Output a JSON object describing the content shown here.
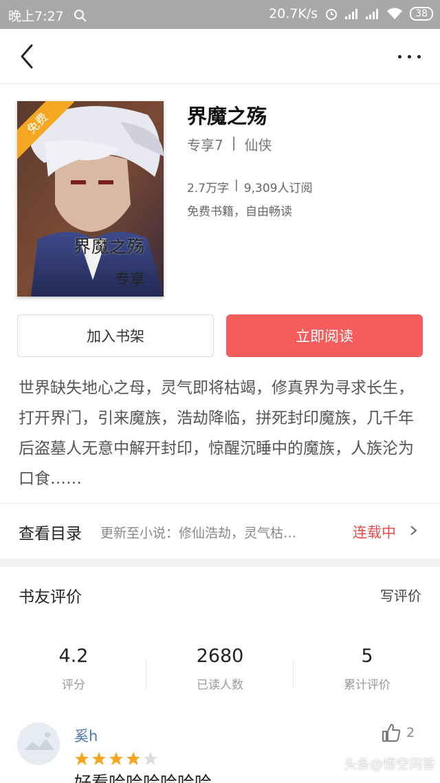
{
  "status_bar": {
    "time": "晚上7:27",
    "network_speed": "20.7K/s",
    "battery": "38"
  },
  "nav": {
    "back_icon": "chevron-left-icon",
    "more_icon": "more-dots-icon"
  },
  "book": {
    "cover_title": "界魔之殇",
    "cover_subtitle": "专享",
    "free_badge": "免费",
    "title": "界魔之殇",
    "author": "专享7",
    "separator": "|",
    "genre": "仙侠",
    "word_count": "2.7万字",
    "subscribers": "9,309人订阅",
    "free_note": "免费书籍，自由畅读"
  },
  "actions": {
    "add_shelf": "加入书架",
    "read_now": "立即阅读"
  },
  "synopsis": "世界缺失地心之母，灵气即将枯竭，修真界为寻求长生，打开界门，引来魔族，浩劫降临，拼死封印魔族，几千年后盗墓人无意中解开封印，惊醒沉睡中的魔族，人族沦为口食……",
  "catalog": {
    "label": "查看目录",
    "update": "更新至小说：修仙浩劫，灵气枯…",
    "status": "连载中"
  },
  "reviews": {
    "title": "书友评价",
    "write": "写评价",
    "stats": [
      {
        "value": "4.2",
        "label": "评分"
      },
      {
        "value": "2680",
        "label": "已读人数"
      },
      {
        "value": "5",
        "label": "累计评价"
      }
    ],
    "items": [
      {
        "name": "奚h",
        "rating": 4,
        "max_rating": 5,
        "likes": "2",
        "text": "好看哈哈哈哈哈哈"
      }
    ]
  },
  "watermark": "头条@悟空问答",
  "colors": {
    "accent_red": "#f55d5d",
    "status_red": "#e94b4b",
    "badge_orange": "#f5a623",
    "link_blue": "#4a78b5",
    "star_gold": "#f5a623"
  }
}
